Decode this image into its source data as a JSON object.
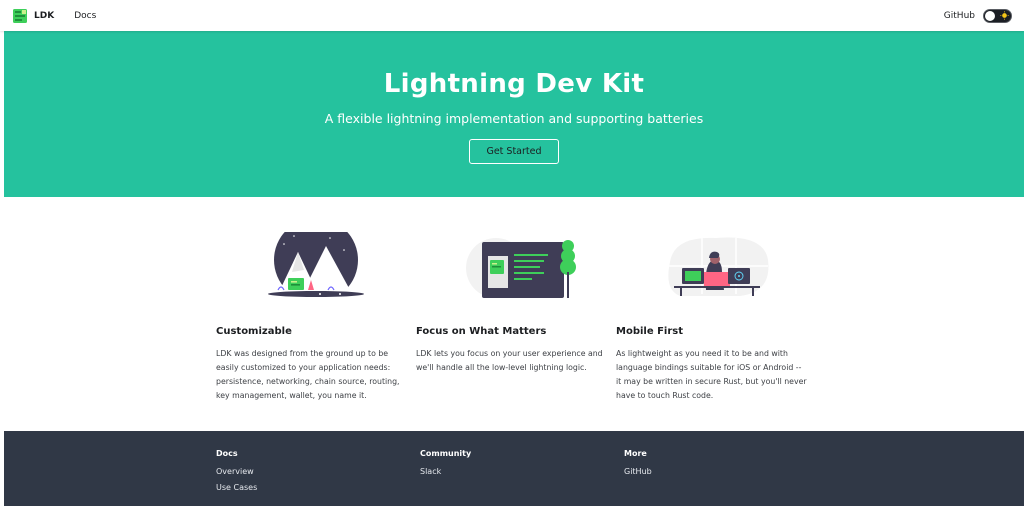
{
  "navbar": {
    "brand": "LDK",
    "links": [
      "Docs"
    ],
    "github": "GitHub"
  },
  "hero": {
    "title": "Lightning Dev Kit",
    "subtitle": "A flexible lightning implementation and supporting batteries",
    "button": "Get Started"
  },
  "features": [
    {
      "title": "Customizable",
      "text": "LDK was designed from the ground up to be easily customized to your application needs: persistence, networking, chain source, routing, key management, wallet, you name it."
    },
    {
      "title": "Focus on What Matters",
      "text": "LDK lets you focus on your user experience and we'll handle all the low-level lightning logic."
    },
    {
      "title": "Mobile First",
      "text": "As lightweight as you need it to be and with language bindings suitable for iOS or Android -- it may be written in secure Rust, but you'll never have to touch Rust code."
    }
  ],
  "footer": {
    "columns": [
      {
        "heading": "Docs",
        "links": [
          "Overview",
          "Use Cases"
        ]
      },
      {
        "heading": "Community",
        "links": [
          "Slack"
        ]
      },
      {
        "heading": "More",
        "links": [
          "GitHub"
        ]
      }
    ]
  },
  "colors": {
    "primary": "#25c29e",
    "footer": "#303846",
    "logo_green": "#3ecf5a"
  },
  "icons": {
    "logo": "ldk-logo-icon",
    "theme_toggle": "sun-icon"
  }
}
